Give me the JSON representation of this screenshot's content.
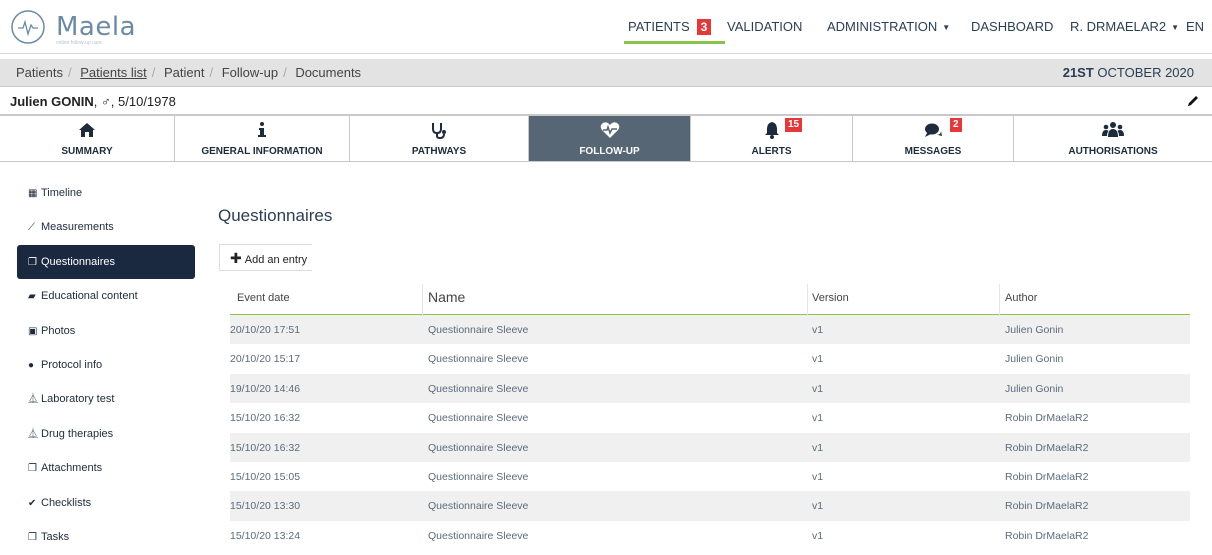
{
  "app": {
    "logo_text": "Maela",
    "logo_tagline": "online follow-up care"
  },
  "nav": {
    "items": [
      {
        "label": "PATIENTS",
        "badge": "3",
        "active": true
      },
      {
        "label": "VALIDATION"
      },
      {
        "label": "ADMINISTRATION",
        "dropdown": true
      },
      {
        "label": "DASHBOARD"
      },
      {
        "label": "R. DRMAELAR2",
        "dropdown": true
      },
      {
        "label": "EN"
      }
    ]
  },
  "breadcrumb": {
    "items": [
      "Patients",
      "Patients list",
      "Patient",
      "Follow-up",
      "Documents"
    ],
    "current_index": 1,
    "date_bold": "21ST",
    "date_rest": " OCTOBER 2020"
  },
  "patient": {
    "name": "Julien GONIN",
    "sex_symbol": "♂",
    "birth_date": "5/10/1978"
  },
  "tabs": [
    {
      "label": "SUMMARY",
      "icon": "home-icon"
    },
    {
      "label": "GENERAL INFORMATION",
      "icon": "info-icon"
    },
    {
      "label": "PATHWAYS",
      "icon": "stethoscope-icon"
    },
    {
      "label": "FOLLOW-UP",
      "icon": "heartbeat-icon",
      "active": true
    },
    {
      "label": "ALERTS",
      "icon": "bell-icon",
      "badge": "15"
    },
    {
      "label": "MESSAGES",
      "icon": "comments-icon",
      "badge": "2"
    },
    {
      "label": "AUTHORISATIONS",
      "icon": "users-icon"
    }
  ],
  "sidebar": {
    "items": [
      {
        "label": "Timeline",
        "icon": "calendar-icon"
      },
      {
        "label": "Measurements",
        "icon": "line-chart-icon"
      },
      {
        "label": "Questionnaires",
        "icon": "copy-icon",
        "active": true
      },
      {
        "label": "Educational content",
        "icon": "book-icon"
      },
      {
        "label": "Photos",
        "icon": "image-icon"
      },
      {
        "label": "Protocol info",
        "icon": "info-circle-icon"
      },
      {
        "label": "Laboratory test",
        "icon": "flask-icon"
      },
      {
        "label": "Drug therapies",
        "icon": "flask-icon"
      },
      {
        "label": "Attachments",
        "icon": "copy-icon"
      },
      {
        "label": "Checklists",
        "icon": "check-circle-icon"
      },
      {
        "label": "Tasks",
        "icon": "copy-icon"
      }
    ]
  },
  "main": {
    "title": "Questionnaires",
    "add_label": "Add an entry",
    "columns": [
      "Event date",
      "Name",
      "Version",
      "Author"
    ],
    "rows": [
      [
        "20/10/20 17:51",
        "Questionnaire Sleeve",
        "v1",
        "Julien Gonin"
      ],
      [
        "20/10/20 15:17",
        "Questionnaire Sleeve",
        "v1",
        "Julien Gonin"
      ],
      [
        "19/10/20 14:46",
        "Questionnaire Sleeve",
        "v1",
        "Julien Gonin"
      ],
      [
        "15/10/20 16:32",
        "Questionnaire Sleeve",
        "v1",
        "Robin DrMaelaR2"
      ],
      [
        "15/10/20 16:32",
        "Questionnaire Sleeve",
        "v1",
        "Robin DrMaelaR2"
      ],
      [
        "15/10/20 15:05",
        "Questionnaire Sleeve",
        "v1",
        "Robin DrMaelaR2"
      ],
      [
        "15/10/20 13:30",
        "Questionnaire Sleeve",
        "v1",
        "Robin DrMaelaR2"
      ],
      [
        "15/10/20 13:24",
        "Questionnaire Sleeve",
        "v1",
        "Robin DrMaelaR2"
      ]
    ]
  },
  "colors": {
    "accent_green": "#8bc34a",
    "badge_red": "#e2393b",
    "active_tab": "#576675",
    "sidebar_active": "#1b2940"
  }
}
